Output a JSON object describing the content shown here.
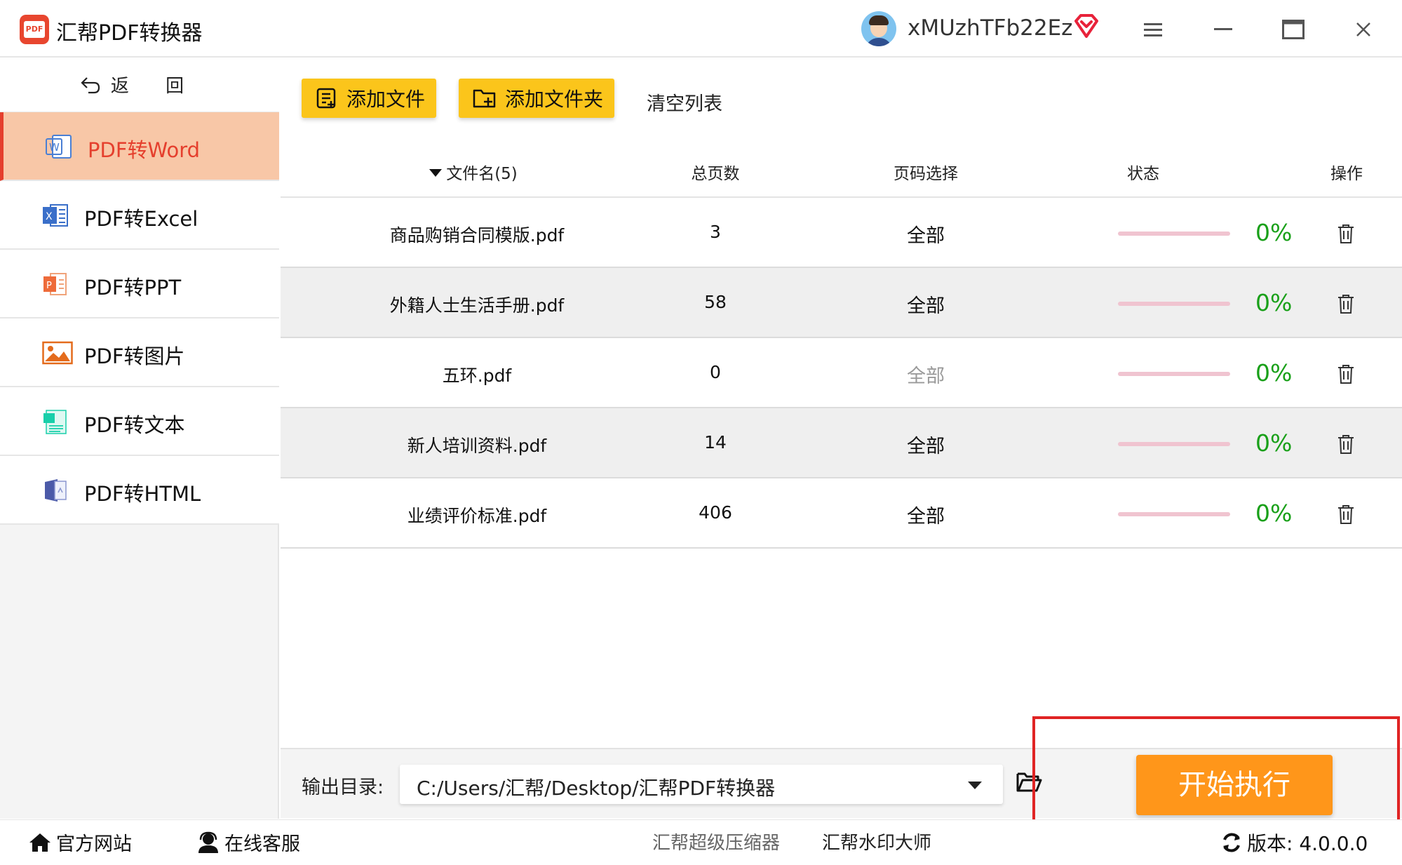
{
  "app": {
    "title": "汇帮PDF转换器",
    "logo_text": "PDF",
    "username": "xMUzhTFb22Ez"
  },
  "sidebar": {
    "back_label": "返 回",
    "items": [
      {
        "label": "PDF转Word",
        "icon": "word-icon"
      },
      {
        "label": "PDF转Excel",
        "icon": "excel-icon"
      },
      {
        "label": "PDF转PPT",
        "icon": "ppt-icon"
      },
      {
        "label": "PDF转图片",
        "icon": "image-icon"
      },
      {
        "label": "PDF转文本",
        "icon": "text-icon"
      },
      {
        "label": "PDF转HTML",
        "icon": "html-icon"
      }
    ],
    "active_index": 0
  },
  "toolbar": {
    "add_file": "添加文件",
    "add_folder": "添加文件夹",
    "clear_list": "清空列表"
  },
  "table": {
    "headers": {
      "name": "文件名(5)",
      "pages": "总页数",
      "range": "页码选择",
      "status": "状态",
      "ops": "操作"
    },
    "rows": [
      {
        "name": "商品购销合同模版.pdf",
        "pages": "3",
        "range": "全部",
        "progress": "0%",
        "progress_value": 0
      },
      {
        "name": "外籍人士生活手册.pdf",
        "pages": "58",
        "range": "全部",
        "progress": "0%",
        "progress_value": 0
      },
      {
        "name": "五环.pdf",
        "pages": "0",
        "range": "全部",
        "progress": "0%",
        "progress_value": 0,
        "range_disabled": true
      },
      {
        "name": "新人培训资料.pdf",
        "pages": "14",
        "range": "全部",
        "progress": "0%",
        "progress_value": 0
      },
      {
        "name": "业绩评价标准.pdf",
        "pages": "406",
        "range": "全部",
        "progress": "0%",
        "progress_value": 0
      }
    ]
  },
  "output": {
    "label": "输出目录:",
    "path": "C:/Users/汇帮/Desktop/汇帮PDF转换器"
  },
  "start_label": "开始执行",
  "footer": {
    "site": "官方网站",
    "service": "在线客服",
    "link1": "汇帮超级压缩器",
    "link2": "汇帮水印大师",
    "version": "版本: 4.0.0.0"
  },
  "colors": {
    "accent_yellow": "#fbc51b",
    "start_orange": "#ff961a",
    "active_red": "#e53f2d",
    "active_bg": "#f8c7a7",
    "progress_green": "#19a019"
  }
}
